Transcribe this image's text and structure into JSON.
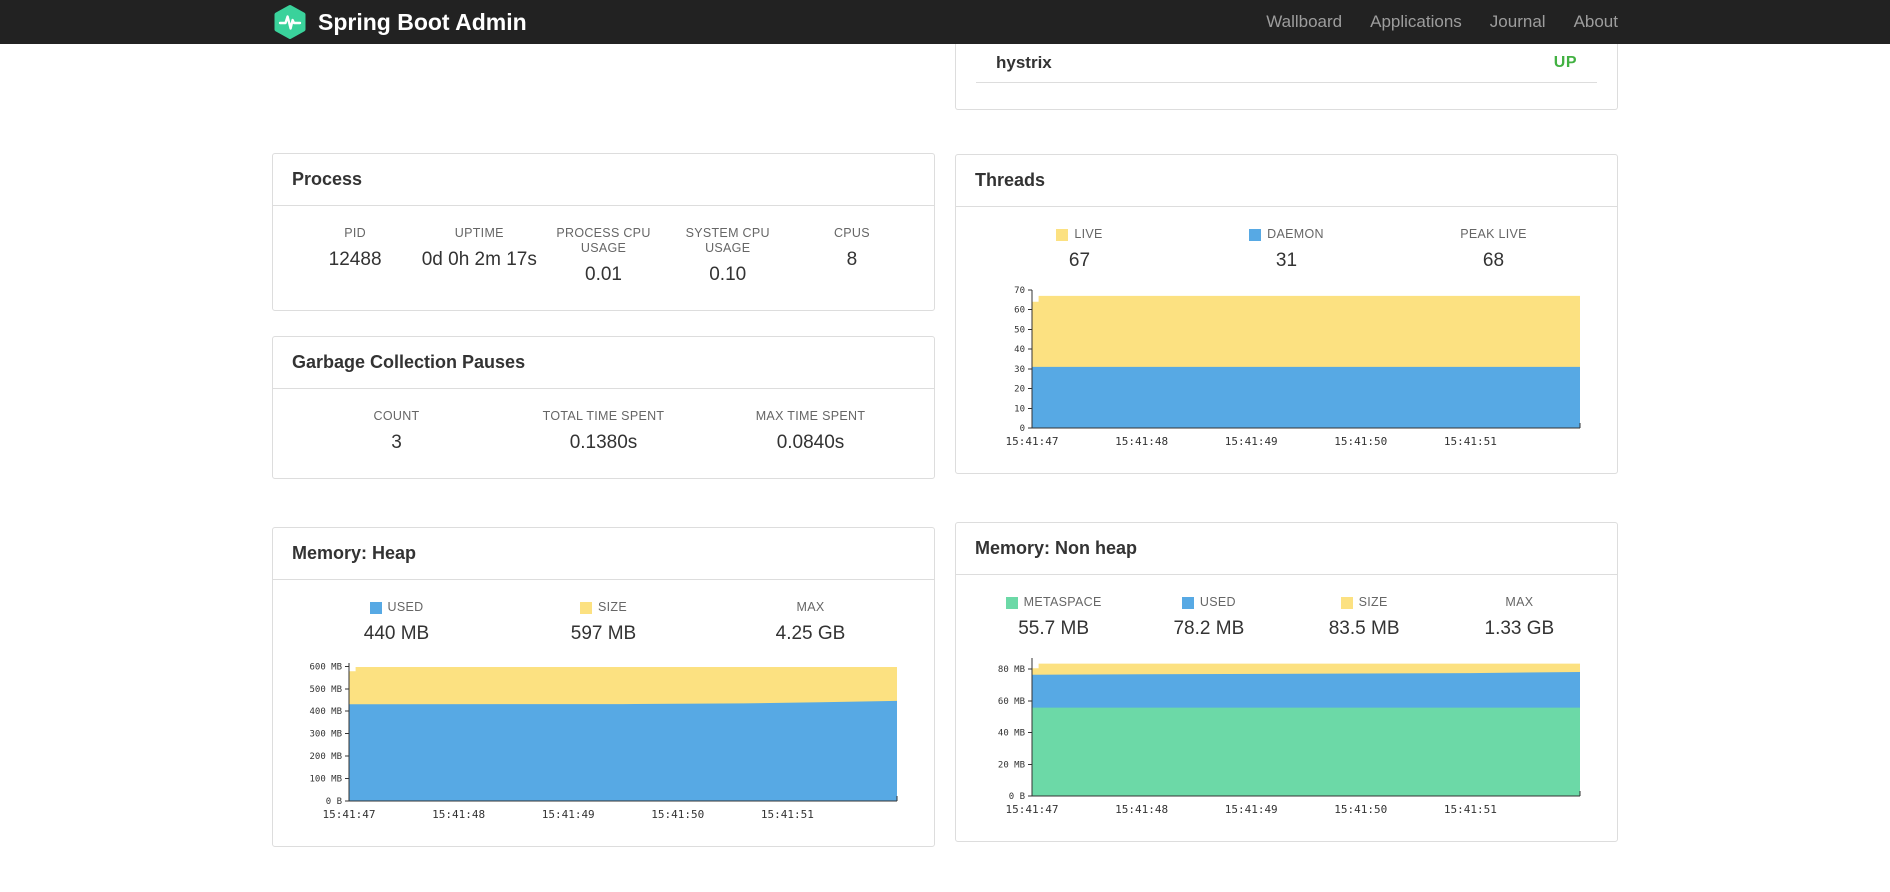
{
  "navbar": {
    "brand": "Spring Boot Admin",
    "links": [
      "Wallboard",
      "Applications",
      "Journal",
      "About"
    ]
  },
  "colors": {
    "navbar_bg": "#222222",
    "brand_green": "#3ad29b",
    "status_up": "#42b142",
    "chart_blue": "#57a9e4",
    "chart_yellow": "#fce181",
    "chart_green": "#6cd9a7"
  },
  "health_panel": {
    "rows": [
      {
        "name": "hystrix",
        "status": "UP"
      }
    ]
  },
  "process_panel": {
    "title": "Process",
    "metrics": [
      {
        "label": "PID",
        "value": "12488"
      },
      {
        "label": "UPTIME",
        "value": "0d 0h 2m 17s"
      },
      {
        "label": "PROCESS CPU USAGE",
        "value": "0.01"
      },
      {
        "label": "SYSTEM CPU USAGE",
        "value": "0.10"
      },
      {
        "label": "CPUS",
        "value": "8"
      }
    ]
  },
  "gc_panel": {
    "title": "Garbage Collection Pauses",
    "metrics": [
      {
        "label": "COUNT",
        "value": "3"
      },
      {
        "label": "TOTAL TIME SPENT",
        "value": "0.1380s"
      },
      {
        "label": "MAX TIME SPENT",
        "value": "0.0840s"
      }
    ]
  },
  "threads_panel": {
    "title": "Threads"
  },
  "heap_panel": {
    "title": "Memory: Heap"
  },
  "nonheap_panel": {
    "title": "Memory: Non heap"
  },
  "chart_data": [
    {
      "type": "area",
      "title": "Threads",
      "legend_position": "top",
      "grid": false,
      "legend": [
        {
          "label": "LIVE",
          "value": "67",
          "swatch": "#fce181"
        },
        {
          "label": "DAEMON",
          "value": "31",
          "swatch": "#57a9e4"
        },
        {
          "label": "PEAK LIVE",
          "value": "68"
        }
      ],
      "x_labels": [
        "15:41:47",
        "15:41:48",
        "15:41:49",
        "15:41:50",
        "15:41:51"
      ],
      "ylim": [
        0,
        70
      ],
      "yticks": [
        {
          "v": 70,
          "label": "70"
        },
        {
          "v": 60,
          "label": "60"
        },
        {
          "v": 50,
          "label": "50"
        },
        {
          "v": 40,
          "label": "40"
        },
        {
          "v": 30,
          "label": "30"
        },
        {
          "v": 20,
          "label": "20"
        },
        {
          "v": 10,
          "label": "10"
        },
        {
          "v": 0,
          "label": "0"
        }
      ],
      "series": [
        {
          "name": "LIVE",
          "color": "#fce181",
          "points": [
            [
              0,
              64
            ],
            [
              0.012,
              64
            ],
            [
              0.012,
              67
            ],
            [
              1,
              67
            ]
          ]
        },
        {
          "name": "DAEMON",
          "color": "#57a9e4",
          "points": [
            [
              0,
              31
            ],
            [
              1,
              31
            ]
          ]
        }
      ]
    },
    {
      "type": "area",
      "title": "Memory: Heap",
      "legend_position": "top",
      "grid": false,
      "legend": [
        {
          "label": "USED",
          "value": "440 MB",
          "swatch": "#57a9e4"
        },
        {
          "label": "SIZE",
          "value": "597 MB",
          "swatch": "#fce181"
        },
        {
          "label": "MAX",
          "value": "4.25 GB"
        }
      ],
      "x_labels": [
        "15:41:47",
        "15:41:48",
        "15:41:49",
        "15:41:50",
        "15:41:51"
      ],
      "ylim": [
        0,
        615
      ],
      "yticks": [
        {
          "v": 600,
          "label": "600 MB"
        },
        {
          "v": 500,
          "label": "500 MB"
        },
        {
          "v": 400,
          "label": "400 MB"
        },
        {
          "v": 300,
          "label": "300 MB"
        },
        {
          "v": 200,
          "label": "200 MB"
        },
        {
          "v": 100,
          "label": "100 MB"
        },
        {
          "v": 0,
          "label": "0 B"
        }
      ],
      "series": [
        {
          "name": "SIZE",
          "color": "#fce181",
          "points": [
            [
              0,
              578
            ],
            [
              0.012,
              578
            ],
            [
              0.012,
              597
            ],
            [
              1,
              597
            ]
          ]
        },
        {
          "name": "USED",
          "color": "#57a9e4",
          "points": [
            [
              0,
              431
            ],
            [
              0.5,
              432
            ],
            [
              0.72,
              435
            ],
            [
              0.86,
              440
            ],
            [
              1,
              446
            ]
          ]
        }
      ]
    },
    {
      "type": "area",
      "title": "Memory: Non heap",
      "legend_position": "top",
      "grid": false,
      "legend": [
        {
          "label": "METASPACE",
          "value": "55.7 MB",
          "swatch": "#6cd9a7"
        },
        {
          "label": "USED",
          "value": "78.2 MB",
          "swatch": "#57a9e4"
        },
        {
          "label": "SIZE",
          "value": "83.5 MB",
          "swatch": "#fce181"
        },
        {
          "label": "MAX",
          "value": "1.33 GB"
        }
      ],
      "x_labels": [
        "15:41:47",
        "15:41:48",
        "15:41:49",
        "15:41:50",
        "15:41:51"
      ],
      "ylim": [
        0,
        87
      ],
      "yticks": [
        {
          "v": 80,
          "label": "80 MB"
        },
        {
          "v": 60,
          "label": "60 MB"
        },
        {
          "v": 40,
          "label": "40 MB"
        },
        {
          "v": 20,
          "label": "20 MB"
        },
        {
          "v": 0,
          "label": "0 B"
        }
      ],
      "series": [
        {
          "name": "SIZE",
          "color": "#fce181",
          "points": [
            [
              0,
              80.5
            ],
            [
              0.012,
              80.5
            ],
            [
              0.012,
              83.5
            ],
            [
              1,
              83.5
            ]
          ]
        },
        {
          "name": "USED",
          "color": "#57a9e4",
          "points": [
            [
              0,
              76.5
            ],
            [
              0.8,
              77.5
            ],
            [
              1,
              78.2
            ]
          ]
        },
        {
          "name": "METASPACE",
          "color": "#6cd9a7",
          "points": [
            [
              0,
              55.7
            ],
            [
              1,
              55.7
            ]
          ]
        }
      ]
    }
  ]
}
